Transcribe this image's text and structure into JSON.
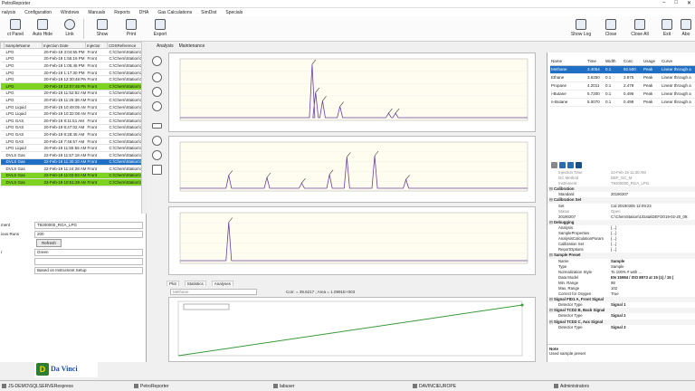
{
  "window": {
    "title": "PetroReporter",
    "controls": [
      "–",
      "□",
      "✕"
    ]
  },
  "menu": [
    "nalysis",
    "Configuration",
    "Windows",
    "Manuals",
    "Reports",
    "DHA",
    "Gas Calculations",
    "SimDist",
    "Specials"
  ],
  "toolbar": {
    "left": [
      {
        "label": "ct Panel",
        "icon": "select-panel-icon"
      },
      {
        "label": "Auto Hide",
        "icon": "auto-hide-icon"
      },
      {
        "label": "Link",
        "icon": "link-icon"
      },
      {
        "label": "Show",
        "icon": "show-icon"
      },
      {
        "label": "Print",
        "icon": "print-icon"
      },
      {
        "label": "Export",
        "icon": "export-icon"
      }
    ],
    "right": [
      {
        "label": "Show Log",
        "icon": "show-log-icon"
      },
      {
        "label": "Close",
        "icon": "close-icon"
      },
      {
        "label": "Close All",
        "icon": "close-all-icon"
      },
      {
        "label": "Exit",
        "icon": "exit-icon"
      },
      {
        "label": "Abo",
        "icon": "about-icon"
      }
    ]
  },
  "sample_table": {
    "columns": [
      "",
      "SampleName",
      "Injection Date",
      "Injector",
      "CDSReference"
    ],
    "rows": [
      {
        "name": "LPG",
        "date": "20-Feb-19 3:04:55 PM",
        "inj": "Front",
        "ref": "C:\\Chem\\Station\\1",
        "style": ""
      },
      {
        "name": "LPG",
        "date": "20-Feb-19 1:55:16 PM",
        "inj": "Front",
        "ref": "C:\\Chem\\Station\\1",
        "style": ""
      },
      {
        "name": "LPG",
        "date": "20-Feb-19 1:05:46 PM",
        "inj": "Front",
        "ref": "C:\\Chem\\Station\\1",
        "style": ""
      },
      {
        "name": "LPG",
        "date": "20-Feb-19 1:17:30 PM",
        "inj": "Front",
        "ref": "C:\\Chem\\Station\\1",
        "style": ""
      },
      {
        "name": "LPG",
        "date": "20-Feb-19 12:30:48 PM",
        "inj": "Front",
        "ref": "C:\\Chem\\Station\\1",
        "style": ""
      },
      {
        "name": "LPG",
        "date": "20-Feb-19 12:07:46 PM",
        "inj": "Front",
        "ref": "C:\\Chem\\Station\\1",
        "style": "green"
      },
      {
        "name": "LPG",
        "date": "20-Feb-19 11:52:52 AM",
        "inj": "Front",
        "ref": "C:\\Chem\\Station\\1",
        "style": ""
      },
      {
        "name": "LPG",
        "date": "20-Feb-19 11:25:38 AM",
        "inj": "Front",
        "ref": "C:\\Chem\\Station\\1",
        "style": ""
      },
      {
        "name": "LPG Liquid",
        "date": "20-Feb-19 10:49:05 AM",
        "inj": "Front",
        "ref": "C:\\Chem\\Station\\1",
        "style": ""
      },
      {
        "name": "LPG Liquid",
        "date": "20-Feb-19 10:32:08 AM",
        "inj": "Front",
        "ref": "C:\\Chem\\Station\\1",
        "style": ""
      },
      {
        "name": "LPG GAS",
        "date": "20-Feb-19 8:11:51 AM",
        "inj": "Front",
        "ref": "C:\\Chem\\Station\\1",
        "style": ""
      },
      {
        "name": "LPG GAS",
        "date": "20-Feb-19 8:47:02 AM",
        "inj": "Front",
        "ref": "C:\\Chem\\Station\\1",
        "style": ""
      },
      {
        "name": "LPG GAS",
        "date": "20-Feb-19 8:28:45 AM",
        "inj": "Front",
        "ref": "C:\\Chem\\Station\\1",
        "style": ""
      },
      {
        "name": "LPG GAS",
        "date": "20-Feb-19 7:46:57 AM",
        "inj": "Front",
        "ref": "C:\\Chem\\Station\\1",
        "style": ""
      },
      {
        "name": "LPG Liquid",
        "date": "20-Feb-19 11:55:55 AM",
        "inj": "Front",
        "ref": "C:\\Chem\\Station\\1",
        "style": ""
      },
      {
        "name": "DVLS Gas",
        "date": "22-Feb-19 11:57:18 AM",
        "inj": "Front",
        "ref": "C:\\Chem\\Station\\1",
        "style": ""
      },
      {
        "name": "DVLS Gas",
        "date": "22-Feb-19 11:30:10 AM",
        "inj": "Front",
        "ref": "C:\\Chem\\Station\\1",
        "style": "blue"
      },
      {
        "name": "DVLS Gas",
        "date": "22-Feb-19 11:24:28 AM",
        "inj": "Front",
        "ref": "C:\\Chem\\Station\\1",
        "style": ""
      },
      {
        "name": "DVLS Gas",
        "date": "22-Feb-19 11:03:03 AM",
        "inj": "Front",
        "ref": "C:\\Chem\\Station\\1",
        "style": "green"
      },
      {
        "name": "DVLS Gas",
        "date": "22-Feb-19 10:51:28 AM",
        "inj": "Front",
        "ref": "C:\\Chem\\Station\\1",
        "style": "green"
      }
    ]
  },
  "left_props": {
    "ment_label": "ment",
    "ment_value": "T9200000_RGA_LPG",
    "runs_label": "ious Runs",
    "runs_value": "200",
    "refresh": "Refresh",
    "color_label": "r",
    "color_value": "Green",
    "method_value": "Based on Instrument Setup"
  },
  "logo": {
    "letter": "D",
    "text": "Da Vinci"
  },
  "main_tabs": [
    "Analysis",
    "Maintenance"
  ],
  "bottom_tabs": [
    "Plot",
    "Statistics",
    "Analyses"
  ],
  "filter": {
    "component": "Methane",
    "stats": "Corr. = 39.6217 ; Area = 1.0991E+003"
  },
  "components": {
    "columns": [
      "Name",
      "Time",
      "Width",
      "Conc",
      "Usage",
      "Curve"
    ],
    "rows": [
      {
        "name": "Methane",
        "time": "3.4054",
        "width": "0.1",
        "conc": "92.500",
        "usage": "Peak",
        "curve": "Linear through a",
        "sel": true
      },
      {
        "name": "Ethane",
        "time": "3.6250",
        "width": "0.1",
        "conc": "3.975",
        "usage": "Peak",
        "curve": "Linear through a",
        "sel": false
      },
      {
        "name": "Propane",
        "time": "4.2011",
        "width": "0.1",
        "conc": "2.479",
        "usage": "Peak",
        "curve": "Linear through a",
        "sel": false
      },
      {
        "name": "i-Butane",
        "time": "5.7200",
        "width": "0.1",
        "conc": "0.496",
        "usage": "Peak",
        "curve": "Linear through a",
        "sel": false
      },
      {
        "name": "n-Butane",
        "time": "5.0070",
        "width": "0.1",
        "conc": "0.499",
        "usage": "Peak",
        "curve": "Linear through a",
        "sel": false
      }
    ]
  },
  "property_grid": [
    {
      "k": "Injection Time",
      "v": "22-Feb-19 11:30 AM",
      "t": "dim"
    },
    {
      "k": "GC Method",
      "v": "DEF_GC_M",
      "t": "dim"
    },
    {
      "k": "Instrument",
      "v": "T9200000_RGA_LPG",
      "t": "dim"
    },
    {
      "k": "Calibration",
      "v": "",
      "t": "cat"
    },
    {
      "k": "Standard",
      "v": "20190207",
      "t": ""
    },
    {
      "k": "Calibration Set",
      "v": "",
      "t": "cat"
    },
    {
      "k": "Set",
      "v": "Cal 20190305 12:09:23",
      "t": ""
    },
    {
      "k": "Status",
      "v": "Open",
      "t": "dim"
    },
    {
      "k": "20190207",
      "v": "C:\\ChemStation\\1\\Data\\DEF\\2019-02-20_09:",
      "t": ""
    },
    {
      "k": "Debugging",
      "v": "",
      "t": "cat"
    },
    {
      "k": "Analysis",
      "v": "{...}",
      "t": ""
    },
    {
      "k": "SampleProperties",
      "v": "{...}",
      "t": ""
    },
    {
      "k": "AnalysisCalculationParam",
      "v": "{...}",
      "t": ""
    },
    {
      "k": "Calibration Set",
      "v": "{...}",
      "t": ""
    },
    {
      "k": "ReportOptions",
      "v": "{...}",
      "t": ""
    },
    {
      "k": "Sample Preset",
      "v": "",
      "t": "cat"
    },
    {
      "k": "Name",
      "v": "Sample",
      "t": "bold"
    },
    {
      "k": "Type",
      "v": "Sample",
      "t": ""
    },
    {
      "k": "Normalization Style",
      "v": "To 100% # with ...",
      "t": ""
    },
    {
      "k": "Data Model",
      "v": "EN 15984 / ISO 8973 at 15 (1) / 15 (",
      "t": "bold"
    },
    {
      "k": "Min. Range",
      "v": "98",
      "t": ""
    },
    {
      "k": "Max. Range",
      "v": "102",
      "t": ""
    },
    {
      "k": "Correct for Oxygen",
      "v": "True",
      "t": ""
    },
    {
      "k": "Signal FID1 A, Front Signal",
      "v": "",
      "t": "cat"
    },
    {
      "k": "Detector Type",
      "v": "Signal 1",
      "t": "bold"
    },
    {
      "k": "Signal TCD2 B, Back Signal",
      "v": "",
      "t": "cat"
    },
    {
      "k": "Detector Type",
      "v": "Signal 2",
      "t": "bold"
    },
    {
      "k": "Signal TCD3 C, Aux Signal",
      "v": "",
      "t": "cat"
    },
    {
      "k": "Detector Type",
      "v": "Signal 3",
      "t": "bold"
    }
  ],
  "note": {
    "title": "Note",
    "text": "Used sample preset"
  },
  "statusbar": [
    {
      "text": "JS-DEMO\\SQLSERVERexpress"
    },
    {
      "text": "PetroReporter"
    },
    {
      "text": "labuser"
    },
    {
      "text": "DAVINCIEUROPE"
    },
    {
      "text": "Administrators"
    }
  ],
  "colors": {
    "selection_blue": "#1f6fc5",
    "highlight_green": "#7ed321",
    "trace_purple": "#6b3fa0",
    "calib_green": "#3a9a3a"
  },
  "chart_data": [
    {
      "type": "line",
      "title": "",
      "description": "FID signal",
      "peaks_x": [
        0.38,
        0.39,
        0.41,
        0.46,
        0.6,
        0.62
      ],
      "peaks_y": [
        0.95,
        0.45,
        0.3,
        0.2,
        0.08,
        0.08
      ]
    },
    {
      "type": "line",
      "title": "",
      "description": "TCD back signal",
      "peaks_x": [
        0.14,
        0.25,
        0.35,
        0.43,
        0.48,
        0.56,
        0.65
      ],
      "peaks_y": [
        0.3,
        0.25,
        0.12,
        0.32,
        0.72,
        0.75,
        0.2
      ]
    },
    {
      "type": "line",
      "title": "",
      "description": "TCD aux signal",
      "peaks_x": [
        0.14
      ],
      "peaks_y": [
        0.85
      ]
    },
    {
      "type": "line",
      "title": "",
      "description": "calibration",
      "x": [
        0,
        1
      ],
      "y": [
        0,
        1
      ]
    }
  ]
}
